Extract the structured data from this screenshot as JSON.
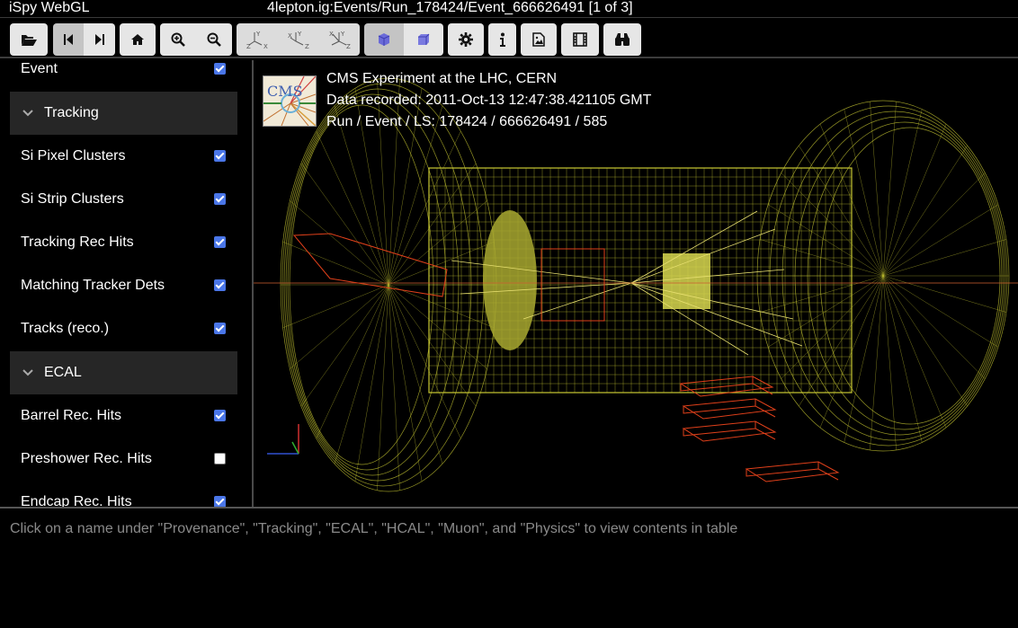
{
  "app": {
    "name": "iSpy WebGL",
    "file_title": "4lepton.ig:Events/Run_178424/Event_666626491 [1 of 3]"
  },
  "toolbar": {
    "buttons": [
      {
        "name": "open-file-button",
        "icon": "folder-open-icon"
      },
      {
        "name": "previous-event-button",
        "icon": "step-backward-icon"
      },
      {
        "name": "next-event-button",
        "icon": "step-forward-icon"
      },
      {
        "name": "home-view-button",
        "icon": "home-icon"
      },
      {
        "name": "zoom-in-button",
        "icon": "zoom-in-icon"
      },
      {
        "name": "zoom-out-button",
        "icon": "zoom-out-icon"
      },
      {
        "name": "view-xy-button",
        "icon": "axes-xy-icon"
      },
      {
        "name": "view-rz-button",
        "icon": "axes-rz-icon"
      },
      {
        "name": "view-3d-button",
        "icon": "axes-3d-icon"
      },
      {
        "name": "perspective-button",
        "icon": "cube-perspective-icon"
      },
      {
        "name": "orthographic-button",
        "icon": "cube-orthographic-icon"
      },
      {
        "name": "settings-button",
        "icon": "gear-icon"
      },
      {
        "name": "info-button",
        "icon": "info-icon"
      },
      {
        "name": "export-image-button",
        "icon": "image-file-icon"
      },
      {
        "name": "animate-button",
        "icon": "film-icon"
      },
      {
        "name": "search-button",
        "icon": "binoculars-icon"
      }
    ]
  },
  "sidebar": {
    "items": [
      {
        "type": "item",
        "label": "Event",
        "checked": true
      },
      {
        "type": "section",
        "label": "Tracking",
        "icon": "chevron-down-icon"
      },
      {
        "type": "item",
        "label": "Si Pixel Clusters",
        "checked": true
      },
      {
        "type": "item",
        "label": "Si Strip Clusters",
        "checked": true
      },
      {
        "type": "item",
        "label": "Tracking Rec Hits",
        "checked": true
      },
      {
        "type": "item",
        "label": "Matching Tracker Dets",
        "checked": true
      },
      {
        "type": "item",
        "label": "Tracks (reco.)",
        "checked": true
      },
      {
        "type": "section",
        "label": "ECAL",
        "icon": "chevron-down-icon"
      },
      {
        "type": "item",
        "label": "Barrel Rec. Hits",
        "checked": true
      },
      {
        "type": "item",
        "label": "Preshower Rec. Hits",
        "checked": false
      },
      {
        "type": "item",
        "label": "Endcap Rec. Hits",
        "checked": true
      }
    ]
  },
  "viewer": {
    "logo_text": "CMS",
    "experiment": "CMS Experiment at the LHC, CERN",
    "recorded": "Data recorded: 2011-Oct-13 12:47:38.421105 GMT",
    "run_event": "Run / Event / LS: 178424 / 666626491 / 585"
  },
  "table_area": {
    "hint": "Click on a name under \"Provenance\", \"Tracking\", \"ECAL\", \"HCAL\", \"Muon\", and \"Physics\" to view contents in table"
  },
  "colors": {
    "detector_wire": "#c8c832",
    "muon_chambers": "#e0401a",
    "tracks": "#e8e070",
    "checkbox": "#4a76e8"
  }
}
